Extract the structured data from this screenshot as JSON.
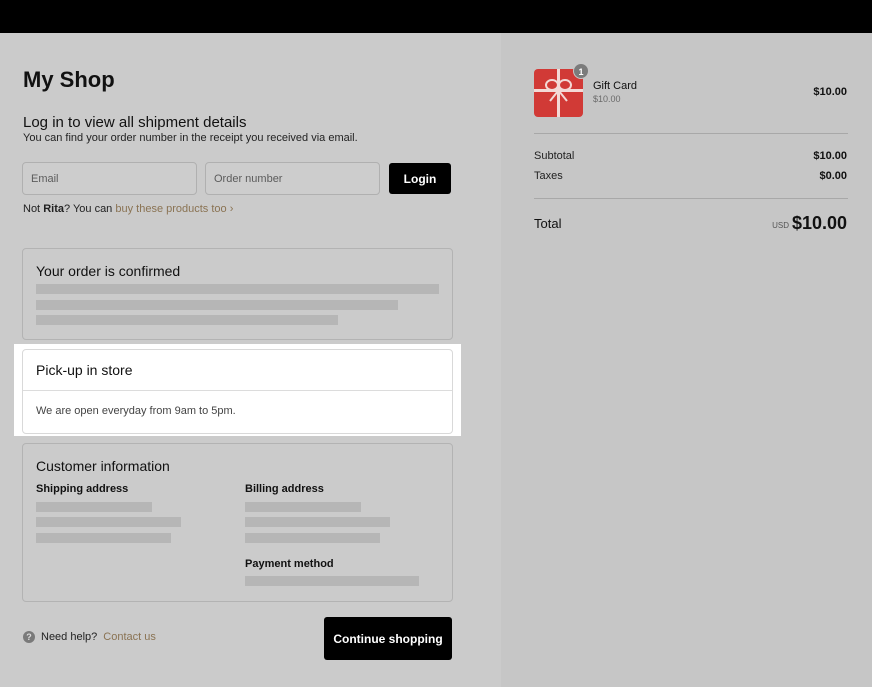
{
  "shop": {
    "title": "My Shop"
  },
  "login": {
    "heading": "Log in to view all shipment details",
    "subtext": "You can find your order number in the receipt you received via email.",
    "email_placeholder": "Email",
    "order_placeholder": "Order number",
    "button_label": "Login",
    "not_prefix": "Not ",
    "user_name": "Rita",
    "not_suffix": "? You can ",
    "buy_link": "buy these products too ›"
  },
  "confirmation": {
    "title": "Your order is confirmed"
  },
  "pickup": {
    "title": "Pick-up in store",
    "text": "We are open everyday from 9am to 5pm."
  },
  "customer": {
    "title": "Customer information",
    "shipping_label": "Shipping address",
    "billing_label": "Billing address",
    "payment_label": "Payment method"
  },
  "footer": {
    "help_icon": "?",
    "help_prefix": "Need help?",
    "contact_link": "Contact us",
    "continue_label": "Continue shopping"
  },
  "summary": {
    "product": {
      "name": "Gift Card",
      "variant_price": "$10.00",
      "quantity": "1",
      "price": "$10.00",
      "icon": "gift-icon",
      "color": "#d13a36"
    },
    "subtotal_label": "Subtotal",
    "subtotal_value": "$10.00",
    "taxes_label": "Taxes",
    "taxes_value": "$0.00",
    "total_label": "Total",
    "currency": "USD",
    "total_value": "$10.00"
  }
}
